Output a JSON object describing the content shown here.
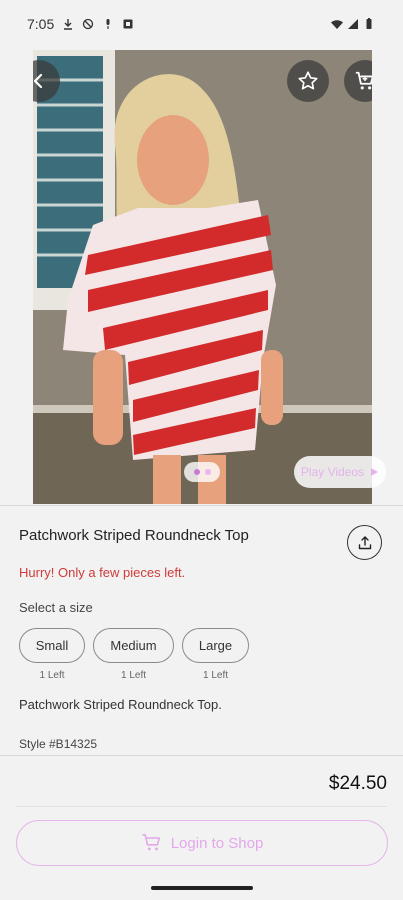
{
  "status_bar": {
    "time": "7:05",
    "icons": [
      "download-icon",
      "shield-icon",
      "mic-off-icon",
      "app-icon",
      "wifi-icon",
      "signal-icon",
      "battery-icon"
    ]
  },
  "product_image": {
    "description_icons": [
      "back-arrow-icon",
      "star-icon",
      "cart-icon"
    ],
    "pager_total": 2,
    "pager_active": 1,
    "play_videos_label": "Play Videos"
  },
  "product": {
    "title": "Patchwork Striped Roundneck Top",
    "stock_notice": "Hurry! Only a few pieces left.",
    "select_size_label": "Select a size",
    "sizes": [
      {
        "label": "Small",
        "stock": "1 Left"
      },
      {
        "label": "Medium",
        "stock": "1 Left"
      },
      {
        "label": "Large",
        "stock": "1 Left"
      }
    ],
    "description": "Patchwork Striped Roundneck Top.",
    "style_number": "Style #B14325",
    "price": "$24.50"
  },
  "actions": {
    "login_label": "Login to Shop"
  },
  "colors": {
    "accent": "#e3a8ea",
    "urgent": "#cf3b3b"
  }
}
